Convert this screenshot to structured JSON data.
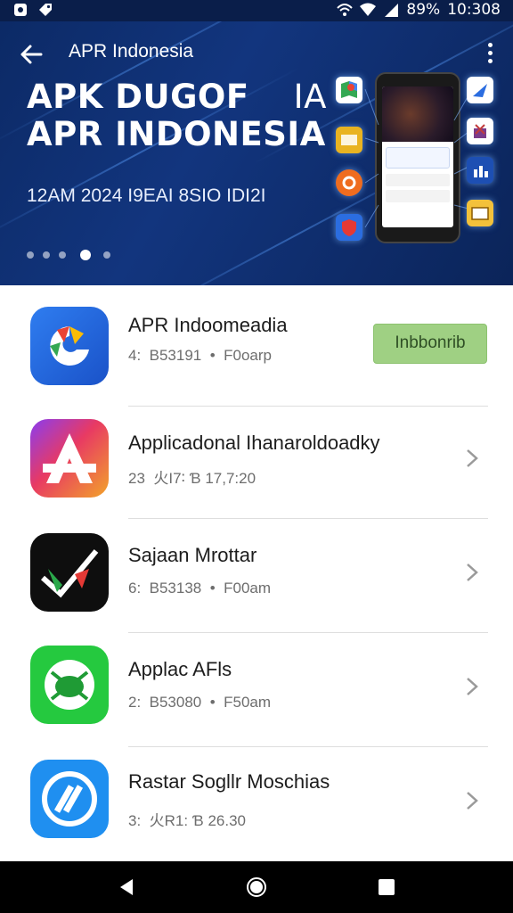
{
  "status_bar": {
    "battery": "89%",
    "time": "10:308"
  },
  "app_bar": {
    "title": "APR Indonesia"
  },
  "hero": {
    "title_line1": "APK DUGOF",
    "title_line1b": "IA",
    "title_line2": "APR INDONESIA",
    "subtitle": "12AM 2024 I9EAI 8SIO IDI2I",
    "carousel_dots": 5,
    "active_dot": 4
  },
  "apps": [
    {
      "name": "APR Indoomeadia",
      "meta_prefix": "4:",
      "meta_a": "B53191",
      "meta_sep": "•",
      "meta_b": "F0oarp",
      "action": "Inbbonrib",
      "icon": "apr-logo-icon"
    },
    {
      "name": "Applicadonal Ihanaroldoadky",
      "meta_prefix": "23",
      "meta_a": "火I7∶",
      "meta_sep": "",
      "meta_b": "Ɓ 17,7:20",
      "icon": "a-letter-logo-icon"
    },
    {
      "name": "Sajaan Mrottar",
      "meta_prefix": "6:",
      "meta_a": "B53138",
      "meta_sep": "•",
      "meta_b": "F00am",
      "icon": "checkmark-logo-icon"
    },
    {
      "name": "Applac AFls",
      "meta_prefix": "2:",
      "meta_a": "B53080",
      "meta_sep": "•",
      "meta_b": "F50am",
      "icon": "bug-logo-icon"
    },
    {
      "name": "Rastar Sogllr Moschias",
      "meta_prefix": "3:",
      "meta_a": "火R1:",
      "meta_sep": "",
      "meta_b": "Ɓ 26.30",
      "icon": "circle-slash-logo-icon"
    }
  ],
  "colors": {
    "hero_bg": "#12357e",
    "install_bg": "#9fd083"
  }
}
